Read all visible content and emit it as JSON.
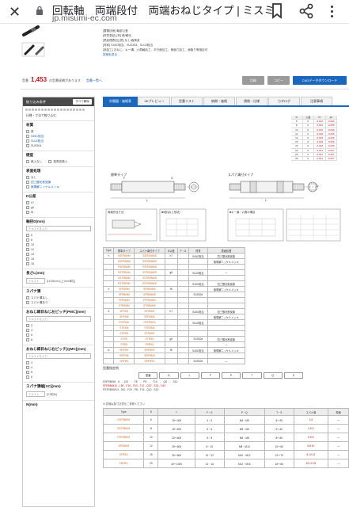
{
  "browser": {
    "title": "回転軸　両端段付　両端おねじタイプ | ミスミ",
    "url": "jp.misumi-ec.com",
    "close_icon": "close-icon",
    "lock_icon": "lock-icon",
    "bookmark_icon": "bookmark-icon",
    "share_icon": "share-icon",
    "more_icon": "more-vert-icon"
  },
  "product": {
    "spec_lines": [
      "[要素技術] 軸部公差",
      "[材質表記] [材] 鉄/硬化",
      "[熱処理表記] [熱] なし/高周波",
      "[材料] S45C相当、SUS304、SUJ2相当",
      "[追加工] おねじ、キー溝、六角軸加工、平行面加工、側面穴加工、面取り等指定可",
      "詳細を見る"
    ],
    "stock_label": "型番",
    "stock_count": "1,453",
    "stock_suffix": "の型番候補があります",
    "stock_link": "型番一覧へ",
    "btn_1": "比較",
    "btn_2": "コピー",
    "btn_cad": "CADデータダウンロード"
  },
  "sidebar": {
    "header": "絞り込み条件",
    "clear": "すべて解除",
    "subtitle": "仕様・寸法で絞り込む",
    "material": {
      "title": "材質",
      "options": [
        "鉄",
        "S45C相当",
        "SUJ2相当",
        "SUS304"
      ]
    },
    "surface": {
      "title": "硬度",
      "options": [
        "焼入なし",
        "高周波焼入"
      ]
    },
    "treatment": {
      "title": "表面処理",
      "options": [
        "なし",
        "四三酸化鉄皮膜",
        "無電解ニッケルメッキ"
      ]
    },
    "d_tolerance": {
      "title": "D公差",
      "options": [
        "h7",
        "g6",
        "f8"
      ]
    },
    "diameter": {
      "title": "軸径D(mm)",
      "placeholder": "テキストを入力",
      "options": [
        "6",
        "8",
        "10",
        "12",
        "13",
        "15",
        "16"
      ]
    },
    "length": {
      "title": "長さL(mm)",
      "placeholder": "テキスト",
      "note": "[15.96mm以上1mm単位]"
    },
    "wrench": {
      "title": "スパナ溝",
      "options": [
        "スパナ溝なし",
        "スパナ溝あり"
      ]
    },
    "thread_left": {
      "title": "おねじ細目ねじ左ピッチ[PMC](mm)",
      "placeholder": "テキストを入力",
      "options": [
        "3",
        "4",
        "5",
        "6"
      ]
    },
    "thread_right": {
      "title": "おねじ細目ねじ右ピッチ[QMC](mm)",
      "placeholder": "テキストを入力",
      "options": [
        "3",
        "4",
        "5",
        "6"
      ]
    },
    "wrench_width": {
      "title": "スパナ溝幅[SC](mm)",
      "placeholder": "テキスト",
      "note": "[0.5刻み]"
    },
    "next_facet": "N(mm)"
  },
  "tabs": [
    "外観図・価格表",
    "3Dプレビュー",
    "型番リスト",
    "納期・価格",
    "規格・仕様",
    "カタログ",
    "注意事項"
  ],
  "drawings": {
    "type_standard": "標準タイプ",
    "type_wrench": "スパナ溝付タイプ",
    "label_l": "L",
    "label_d": "D",
    "label_f": "F",
    "label_g": "G",
    "caption_left": "両端外径寸法",
    "caption_mid": "■S部(ねじ形状)",
    "caption_right": "■キー溝・六角の場合"
  },
  "dim_table": {
    "head": [
      "D",
      "公差",
      "h7",
      "g6"
    ],
    "rows": [
      [
        "6",
        "0",
        "-0.012",
        "-0.004"
      ],
      [
        "8",
        "0",
        "-0.015",
        "-0.005"
      ],
      [
        "10",
        "0",
        "-0.015",
        "-0.005"
      ],
      [
        "12",
        "0",
        "-0.018",
        "-0.006"
      ],
      [
        "13",
        "0",
        "-0.018",
        "-0.006"
      ],
      [
        "15",
        "0",
        "-0.018",
        "-0.006"
      ],
      [
        "16",
        "0",
        "-0.018",
        "-0.006"
      ],
      [
        "20",
        "0",
        "-0.021",
        "-0.007"
      ],
      [
        "25",
        "0",
        "-0.021",
        "-0.007"
      ],
      [
        "30",
        "0",
        "-0.021",
        "-0.007"
      ]
    ]
  },
  "type_table": {
    "headers": [
      "Type",
      "標準タイプ",
      "スパナ溝付タイプ",
      "D公差",
      "F・G",
      "材質",
      "表面処理"
    ],
    "rows": [
      [
        "①",
        "SSFRBHM",
        "SSFRBHMS",
        "h7",
        "",
        "S45C相当",
        "四三酸化鉄皮膜"
      ],
      [
        "",
        "SSFRBMM",
        "SSFRBMMS",
        "",
        "",
        "",
        "無電解ニッケルメッキ"
      ],
      [
        "",
        "PSFRBHM",
        "PSFRBHMS",
        "",
        "",
        "",
        ""
      ],
      [
        "",
        "SSTRBHM",
        "SSTRBHMS",
        "g6",
        "",
        "SUJ2相当",
        "—"
      ],
      [
        "",
        "SSTRBNM",
        "SSTRBNMS",
        "",
        "",
        "",
        ""
      ],
      [
        "",
        "PSTRBHM",
        "PSTRBHMS",
        "",
        "",
        "S45C相当",
        "四三酸化鉄皮膜"
      ],
      [
        "②",
        "SFRBHM",
        "SFRBHMS",
        "f8",
        "",
        "",
        "無電解ニッケルメッキ"
      ],
      [
        "",
        "SFRBMM",
        "SFRBMMS",
        "",
        "",
        "SUS304",
        ""
      ],
      [
        "",
        "PFRBHM",
        "PFRBHMS",
        "",
        "",
        "",
        ""
      ],
      [
        "",
        "STRBHM",
        "STRBHMS",
        "",
        "",
        "",
        ""
      ],
      [
        "③",
        "SFRSH",
        "SFRSHS",
        "h7",
        "",
        "S45C相当",
        "四三酸化鉄皮膜"
      ],
      [
        "",
        "SFRSM",
        "SFRSMS",
        "",
        "",
        "",
        "無電解ニッケルメッキ"
      ],
      [
        "",
        "PSTRSH",
        "PSTRSHS",
        "",
        "",
        "SUJ2相当",
        ""
      ],
      [
        "",
        "STRSM",
        "STRSMS",
        "",
        "",
        "",
        ""
      ],
      [
        "",
        "STRSH",
        "STRSHS",
        "",
        "",
        "",
        ""
      ],
      [
        "",
        "STRS",
        "STRSS",
        "g6",
        "",
        "SUS304",
        "四三酸化鉄皮膜"
      ],
      [
        "",
        "PSRS",
        "PSRSS",
        "",
        "",
        "",
        "—"
      ],
      [
        "④",
        "SRFRH",
        "SRFRHS",
        "f8",
        "",
        "S45C相当",
        "無電解ニッケルメッキ"
      ],
      [
        "",
        "SRFRM",
        "SRFRMS",
        "",
        "",
        "",
        ""
      ],
      [
        "",
        "SRFRS",
        "SRFRSS",
        "",
        "",
        "SUS304",
        "—"
      ]
    ]
  },
  "order": {
    "title": "型番指定例",
    "strip": [
      "型番",
      "D",
      "L",
      "F",
      "P",
      "T",
      "Q",
      "S"
    ],
    "lines": [
      "SSFRBHM　6　- 100　-　F8　-　P5　-　T10　-　Q8　-　S10",
      "SFRBMM10 - 150 - F15 - P10 - T12 - Q12 - S15 - N10",
      "PSTRBHM13 - 200 - F20 - P8 - T15 - Q10 - S20"
    ],
    "note": "※ 詳細は各寸法表をご参照ください"
  },
  "spec_table": {
    "headers": [
      "Type",
      "D",
      "L",
      "F・G",
      "P・Q",
      "T・S",
      "スパナ溝",
      "単価"
    ],
    "rows": [
      [
        "SSFRBHM",
        "6",
        "15〜400",
        "4・5",
        "M4・M5",
        "5〜30",
        "3.5",
        "—"
      ],
      [
        "SSTRBHM",
        "8",
        "15〜500",
        "5・6",
        "M5・M6",
        "6〜40",
        "4 5 6",
        "—"
      ],
      [
        "PSFRBHM",
        "10",
        "20〜600",
        "6・8",
        "M6・M8",
        "8〜50",
        "5 6 8",
        "—"
      ],
      [
        "SFRBHM",
        "12",
        "25〜800",
        "8・10",
        "M8・M10",
        "10〜60",
        "6 8 10",
        "—"
      ],
      [
        "SFRSH",
        "15",
        "30〜800",
        "10・12",
        "M10・M12",
        "12〜70",
        "8 10 12",
        "—"
      ],
      [
        "SRFRH",
        "20",
        "40〜1000",
        "12・16",
        "M12・M16",
        "15〜80",
        "10 12 15",
        "—"
      ]
    ]
  }
}
